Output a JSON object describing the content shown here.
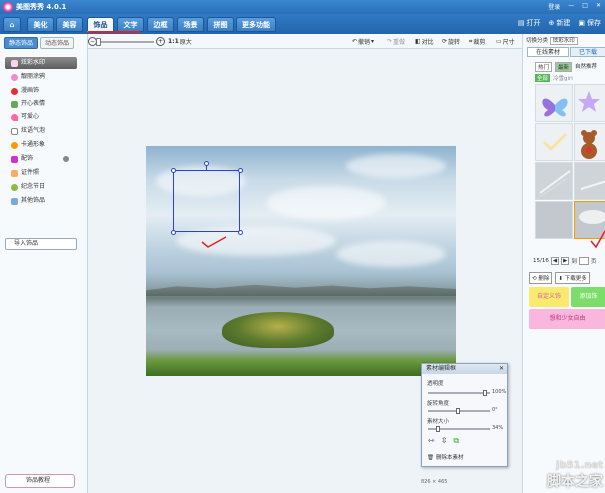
{
  "app": {
    "title": "美图秀秀 4.0.1"
  },
  "titlebar": {
    "login": "登录",
    "btns": [
      "—",
      "□",
      "✕"
    ]
  },
  "menu": {
    "tabs": [
      "美化",
      "美容",
      "饰品",
      "文字",
      "边框",
      "场景",
      "拼图",
      "更多功能 ▾"
    ],
    "active_index": 2,
    "right": {
      "open": "打开",
      "new": "新建",
      "save": "保存"
    }
  },
  "toolbar": {
    "zoom_ratio": "1:1",
    "original_size": "原大",
    "undo": "撤销",
    "redo": "重做",
    "compare": "对比",
    "rotate": "旋转",
    "crop": "裁剪",
    "size": "尺寸"
  },
  "left": {
    "tabs": [
      "静态饰品",
      "动态饰品"
    ],
    "categories": [
      "炫彩水印",
      "靓丽涂鸦",
      "漫画饰",
      "开心表情",
      "可爱心",
      "炫语气泡",
      "卡通形象",
      "配饰",
      "证件照",
      "纪念节日",
      "其他饰品"
    ],
    "selected_index": 0,
    "import": "导入饰品",
    "help": "饰品教程"
  },
  "right": {
    "category_label": "切换分类",
    "category_value": "炫彩水印",
    "tabs": [
      "在线素材",
      "已下载"
    ],
    "subtabs": [
      "热门",
      "最新",
      "自然推荐"
    ],
    "filter": "全部",
    "filter_hint": "冷雪girl",
    "page": "15/16",
    "goto": "到",
    "page_unit": "页",
    "btn_delete": "删除",
    "btn_download": "下载更多",
    "btn_extra": "",
    "promo1": "自定义饰",
    "promo2": "添加饰",
    "promo3": "想和少女自由"
  },
  "editor": {
    "title": "素材编辑框",
    "opacity_label": "透明度",
    "opacity_value": "100%",
    "rotate_label": "旋转角度",
    "rotate_value": "0°",
    "size_label": "素材大小",
    "size_value": "34%",
    "delete": "删除本素材"
  },
  "status": {
    "dims": "826 × 465"
  },
  "watermark": {
    "url": "jb51.net",
    "name": "脚本之家"
  },
  "colors": {
    "menu_blue": "#2a6fb8",
    "accent_red": "#d22222",
    "selection_blue": "#3040c8"
  }
}
